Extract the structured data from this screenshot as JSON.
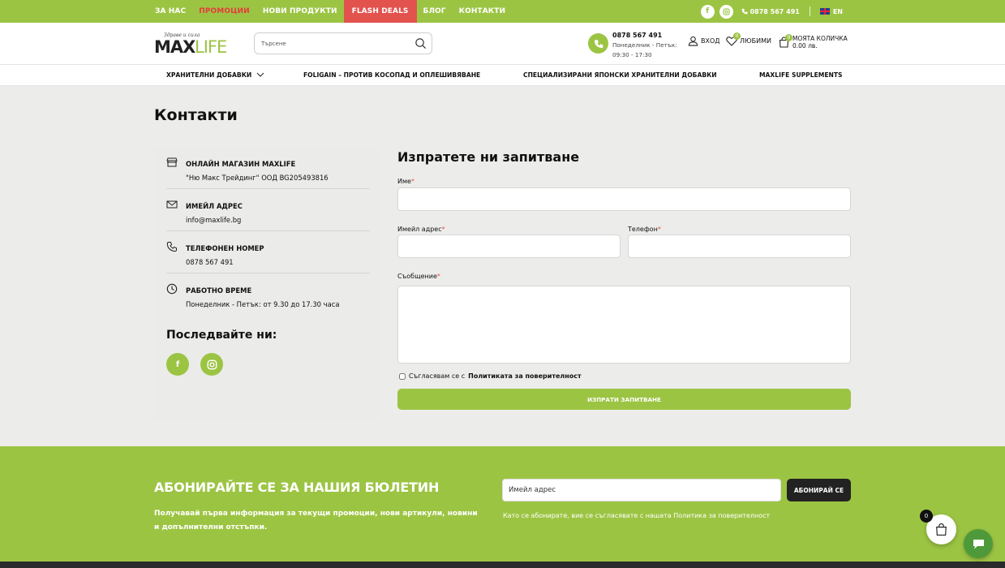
{
  "topbar": {
    "links": [
      {
        "label": "ЗА НАС"
      },
      {
        "label": "ПРОМОЦИИ"
      },
      {
        "label": "НОВИ ПРОДУКТИ"
      },
      {
        "label": "FLASH DEALS"
      },
      {
        "label": "БЛОГ"
      },
      {
        "label": "КОНТАКТИ"
      }
    ],
    "phone": "0878 567 491",
    "language": "EN",
    "colors": {
      "bar": "#9cc443",
      "promo": "#e63b3b",
      "flash_bg": "#e2534e"
    }
  },
  "header": {
    "logo": {
      "tagline": "Здраве и сила",
      "part1": "MAX",
      "part2": "LIFE"
    },
    "search": {
      "placeholder": "Търсене",
      "icon": "search-icon"
    },
    "contact": {
      "phone": "0878 567 491",
      "hours_line1": "Понеделник - Петък:",
      "hours_line2": "09:30 - 17:30"
    },
    "login_label": "ВХОД",
    "favorites_label": "ЛЮБИМИ",
    "favorites_count": "0",
    "cart_label": "МОЯТА КОЛИЧКА",
    "cart_total": "0.00 лв.",
    "cart_count": "0"
  },
  "catnav": {
    "items": [
      {
        "label": "ХРАНИТЕЛНИ ДОБАВКИ"
      },
      {
        "label": "FOLIGAIN – ПРОТИВ КОСОПАД И ОПЛЕШИВЯВАНЕ"
      },
      {
        "label": "СПЕЦИАЛИЗИРАНИ ЯПОНСКИ ХРАНИТЕЛНИ ДОБАВКИ"
      },
      {
        "label": "MAXLIFE SUPPLEMENTS"
      }
    ]
  },
  "page": {
    "title": "Контакти"
  },
  "info": {
    "items": [
      {
        "label": "ОНЛАЙН МАГАЗИН MAXLIFE",
        "value": "\"Ню Макс Трейдинг\" ООД BG205493816",
        "icon": "store-icon"
      },
      {
        "label": "ИМЕЙЛ АДРЕС",
        "value": "info@maxlife.bg",
        "icon": "envelope-icon"
      },
      {
        "label": "ТЕЛЕФОНЕН НОМЕР",
        "value": "0878 567 491",
        "icon": "phone-icon"
      },
      {
        "label": "РАБОТНО ВРЕМЕ",
        "value": "Понеделник - Петък: от 9.30 до 17.30 часа",
        "icon": "clock-icon"
      }
    ],
    "follow_title": "Последвайте ни:"
  },
  "form": {
    "title": "Изпратете ни запитване",
    "name_label": "Име",
    "email_label": "Имейл адрес",
    "phone_label": "Телефон",
    "message_label": "Съобщение",
    "required_mark": "*",
    "agree_text": "Съгласявам се с",
    "agree_link": "Политиката за поверителност",
    "submit_label": "ИЗПРАТИ ЗАПИТВАНЕ"
  },
  "newsletter": {
    "title": "АБОНИРАЙТЕ СЕ ЗА НАШИЯ БЮЛЕТИН",
    "description": "Получавай първа информация за текущи промоции, нови артикули, новини и допълнителни отстъпки.",
    "input_placeholder": "Имейл адрес",
    "button_label": "АБОНИРАЙ СЕ",
    "note": "Като се абонирате, вие се съгласявате с нашата Политика за поверителност"
  },
  "floating": {
    "cart_count": "0"
  }
}
